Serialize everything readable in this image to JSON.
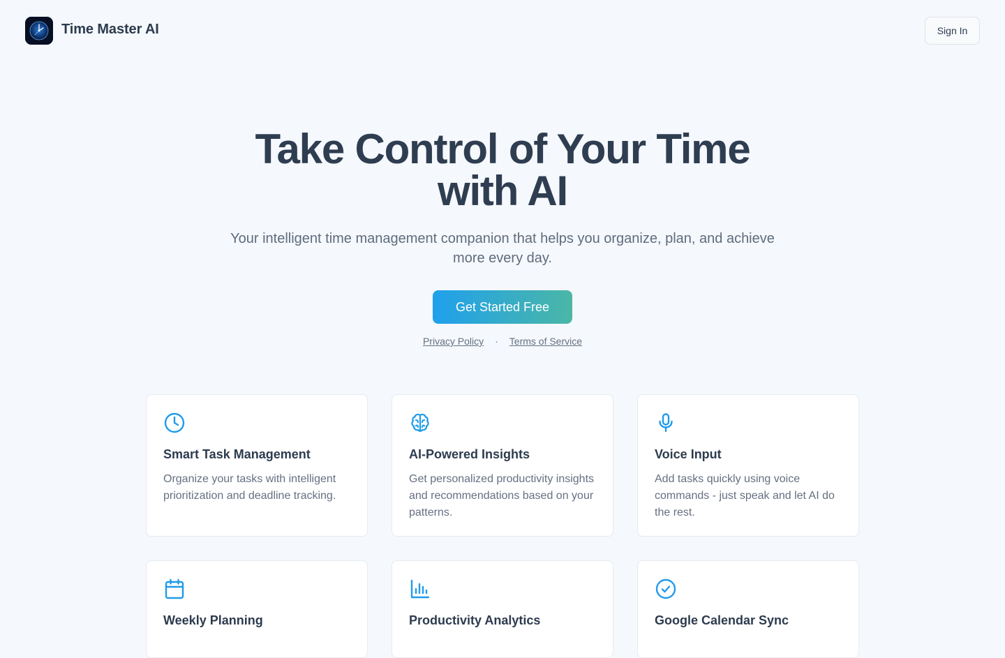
{
  "header": {
    "brand": "Time Master AI",
    "logo_icon": "clock-logo-icon",
    "signin_label": "Sign In"
  },
  "hero": {
    "title_line1": "Take Control of Your Time",
    "title_line2": "with AI",
    "subtitle": "Your intelligent time management companion that helps you organize, plan, and achieve more every day.",
    "cta_label": "Get Started Free"
  },
  "links": {
    "privacy": "Privacy Policy",
    "separator": "·",
    "terms": "Terms of Service"
  },
  "features": [
    {
      "icon": "clock-icon",
      "title": "Smart Task Management",
      "desc": "Organize your tasks with intelligent prioritization and deadline tracking."
    },
    {
      "icon": "brain-icon",
      "title": "AI-Powered Insights",
      "desc": "Get personalized productivity insights and recommendations based on your patterns."
    },
    {
      "icon": "microphone-icon",
      "title": "Voice Input",
      "desc": "Add tasks quickly using voice commands - just speak and let AI do the rest."
    },
    {
      "icon": "calendar-icon",
      "title": "Weekly Planning",
      "desc": ""
    },
    {
      "icon": "bar-chart-icon",
      "title": "Productivity Analytics",
      "desc": ""
    },
    {
      "icon": "check-circle-icon",
      "title": "Google Calendar Sync",
      "desc": ""
    }
  ],
  "colors": {
    "background": "#f5f8fc",
    "accent": "#1f9bea",
    "cta_gradient_start": "#1fa0ec",
    "cta_gradient_end": "#4bb7a6",
    "heading": "#2f3d51",
    "muted_text": "#647082"
  }
}
